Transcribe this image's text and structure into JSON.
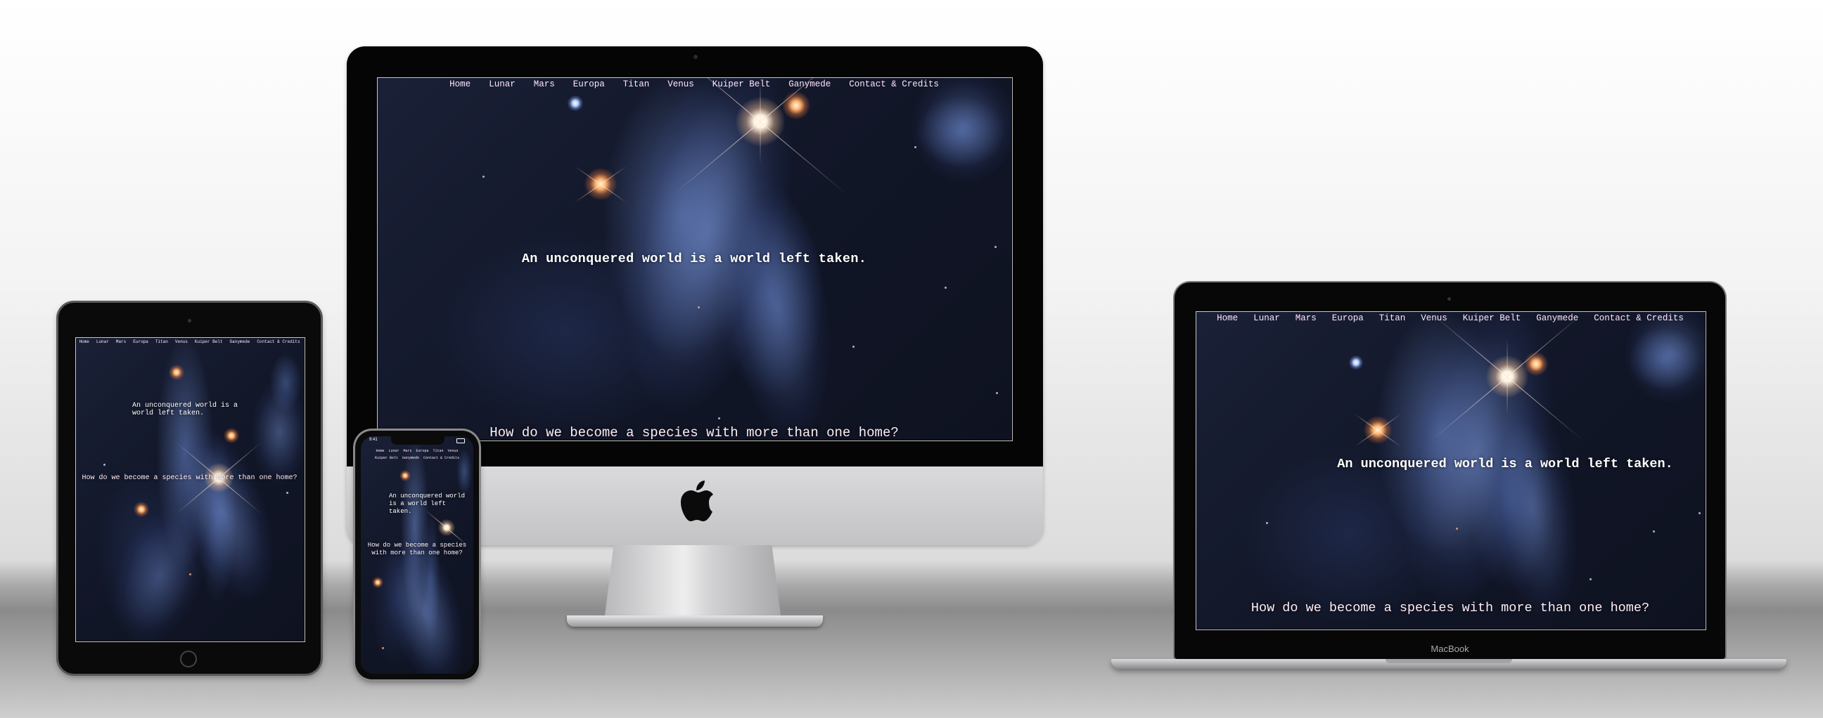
{
  "site": {
    "nav": [
      "Home",
      "Lunar",
      "Mars",
      "Europa",
      "Titan",
      "Venus",
      "Kuiper Belt",
      "Ganymede",
      "Contact & Credits"
    ],
    "tagline": "An unconquered world is a world left taken.",
    "question": "How do we become a species with more than one home?"
  },
  "devices": {
    "laptop_brand": "MacBook",
    "phone_status_time": "9:41"
  },
  "colors": {
    "nav_text": "#ffe6ff",
    "heading_text": "#ffffff",
    "space_dark": "#121729",
    "nebula_blue": "#6e8cd2"
  },
  "icons": {
    "imac_logo": "apple-logo-icon",
    "ipad_button": "home-button-icon"
  }
}
